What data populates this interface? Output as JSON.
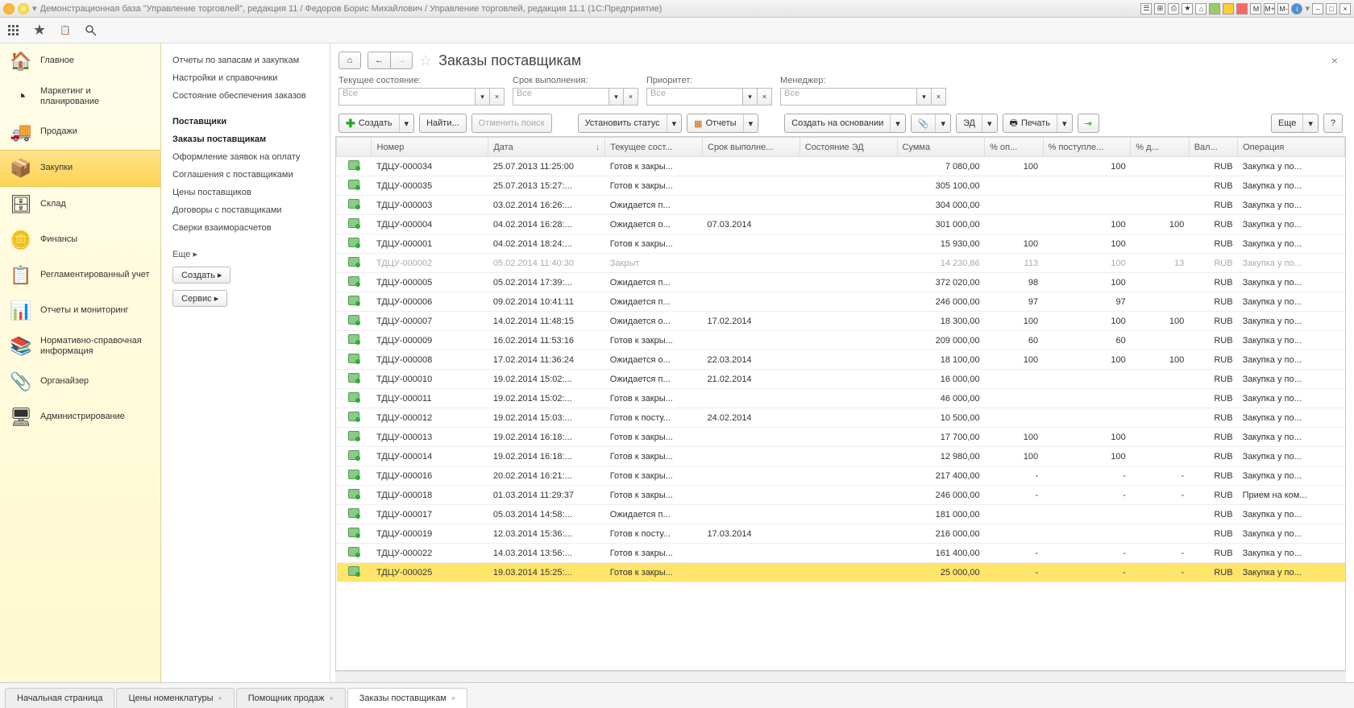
{
  "title": "Демонстрационная база \"Управление торговлей\", редакция 11 / Федоров Борис Михайлович / Управление торговлей, редакция 11.1  (1С:Предприятие)",
  "titleButtons": {
    "m": "M",
    "mp": "M+",
    "mm": "M-"
  },
  "sidebar": [
    {
      "label": "Главное",
      "icon": "home"
    },
    {
      "label": "Маркетинг и планирование",
      "icon": "pie"
    },
    {
      "label": "Продажи",
      "icon": "truck"
    },
    {
      "label": "Закупки",
      "icon": "boxes",
      "active": true
    },
    {
      "label": "Склад",
      "icon": "shelf"
    },
    {
      "label": "Финансы",
      "icon": "coins"
    },
    {
      "label": "Регламентированный учет",
      "icon": "doc"
    },
    {
      "label": "Отчеты и мониторинг",
      "icon": "chart"
    },
    {
      "label": "Нормативно-справочная информация",
      "icon": "books"
    },
    {
      "label": "Органайзер",
      "icon": "clip"
    },
    {
      "label": "Администрирование",
      "icon": "server"
    }
  ],
  "subpanel": {
    "links": [
      {
        "t": "Отчеты по запасам и закупкам"
      },
      {
        "t": "Настройки и справочники"
      },
      {
        "t": "Состояние обеспечения заказов"
      },
      {
        "t": "Поставщики",
        "bold": true
      },
      {
        "t": "Заказы поставщикам",
        "bold": true
      },
      {
        "t": "Оформление заявок на оплату"
      },
      {
        "t": "Соглашения с поставщиками"
      },
      {
        "t": "Цены поставщиков"
      },
      {
        "t": "Договоры с поставщиками"
      },
      {
        "t": "Сверки взаиморасчетов"
      }
    ],
    "more": "Еще ▸",
    "btn_create": "Создать ▸",
    "btn_service": "Сервис ▸"
  },
  "main": {
    "title": "Заказы поставщикам",
    "filters": {
      "state": {
        "label": "Текущее состояние:",
        "value": "Все"
      },
      "deadline": {
        "label": "Срок выполнения:",
        "value": "Все"
      },
      "priority": {
        "label": "Приоритет:",
        "value": "Все"
      },
      "manager": {
        "label": "Менеджер:",
        "value": "Все"
      }
    },
    "buttons": {
      "create": "Создать",
      "find": "Найти...",
      "cancel_search": "Отменить поиск",
      "set_status": "Установить статус",
      "reports": "Отчеты",
      "create_based": "Создать на основании",
      "ed": "ЭД",
      "print": "Печать",
      "more": "Еще",
      "help": "?"
    },
    "columns": [
      "",
      "Номер",
      "Дата",
      "Текущее сост...",
      "Срок выполне...",
      "Состояние ЭД",
      "Сумма",
      "% оп...",
      "% поступле...",
      "% д...",
      "Вал...",
      "Операция"
    ],
    "rows": [
      {
        "n": "ТДЦУ-000034",
        "d": "25.07.2013 11:25:00",
        "s": "Готов к закры...",
        "dl": "",
        "sum": "7 080,00",
        "op": "100",
        "pp": "100",
        "pd": "",
        "cur": "RUB",
        "oper": "Закупка у по..."
      },
      {
        "n": "ТДЦУ-000035",
        "d": "25.07.2013 15:27:...",
        "s": "Готов к закры...",
        "dl": "",
        "sum": "305 100,00",
        "op": "",
        "pp": "",
        "pd": "",
        "cur": "RUB",
        "oper": "Закупка у по..."
      },
      {
        "n": "ТДЦУ-000003",
        "d": "03.02.2014 16:26:...",
        "s": "Ожидается п...",
        "dl": "",
        "sum": "304 000,00",
        "op": "",
        "pp": "",
        "pd": "",
        "cur": "RUB",
        "oper": "Закупка у по..."
      },
      {
        "n": "ТДЦУ-000004",
        "d": "04.02.2014 16:28:...",
        "s": "Ожидается о...",
        "dl": "07.03.2014",
        "sum": "301 000,00",
        "op": "",
        "pp": "100",
        "pd": "100",
        "cur": "RUB",
        "oper": "Закупка у по...",
        "red": true
      },
      {
        "n": "ТДЦУ-000001",
        "d": "04.02.2014 18:24:...",
        "s": "Готов к закры...",
        "dl": "",
        "sum": "15 930,00",
        "op": "100",
        "pp": "100",
        "pd": "",
        "cur": "RUB",
        "oper": "Закупка у по..."
      },
      {
        "n": "ТДЦУ-000002",
        "d": "05.02.2014 11:40:30",
        "s": "Закрыт",
        "dl": "",
        "sum": "14 230,86",
        "op": "113",
        "pp": "100",
        "pd": "13",
        "cur": "RUB",
        "oper": "Закупка у по...",
        "closed": true
      },
      {
        "n": "ТДЦУ-000005",
        "d": "05.02.2014 17:39:...",
        "s": "Ожидается п...",
        "dl": "",
        "sum": "372 020,00",
        "op": "98",
        "pp": "100",
        "pd": "",
        "cur": "RUB",
        "oper": "Закупка у по..."
      },
      {
        "n": "ТДЦУ-000006",
        "d": "09.02.2014 10:41:11",
        "s": "Ожидается п...",
        "dl": "",
        "sum": "246 000,00",
        "op": "97",
        "pp": "97",
        "pd": "",
        "cur": "RUB",
        "oper": "Закупка у по..."
      },
      {
        "n": "ТДЦУ-000007",
        "d": "14.02.2014 11:48:15",
        "s": "Ожидается о...",
        "dl": "17.02.2014",
        "sum": "18 300,00",
        "op": "100",
        "pp": "100",
        "pd": "100",
        "cur": "RUB",
        "oper": "Закупка у по...",
        "red": true
      },
      {
        "n": "ТДЦУ-000009",
        "d": "16.02.2014 11:53:16",
        "s": "Готов к закры...",
        "dl": "",
        "sum": "209 000,00",
        "op": "60",
        "pp": "60",
        "pd": "",
        "cur": "RUB",
        "oper": "Закупка у по..."
      },
      {
        "n": "ТДЦУ-000008",
        "d": "17.02.2014 11:36:24",
        "s": "Ожидается о...",
        "dl": "22.03.2014",
        "sum": "18 100,00",
        "op": "100",
        "pp": "100",
        "pd": "100",
        "cur": "RUB",
        "oper": "Закупка у по...",
        "red": true
      },
      {
        "n": "ТДЦУ-000010",
        "d": "19.02.2014 15:02:...",
        "s": "Ожидается п...",
        "dl": "21.02.2014",
        "sum": "16 000,00",
        "op": "",
        "pp": "",
        "pd": "",
        "cur": "RUB",
        "oper": "Закупка у по...",
        "red": true
      },
      {
        "n": "ТДЦУ-000011",
        "d": "19.02.2014 15:02:...",
        "s": "Готов к закры...",
        "dl": "",
        "sum": "46 000,00",
        "op": "",
        "pp": "",
        "pd": "",
        "cur": "RUB",
        "oper": "Закупка у по..."
      },
      {
        "n": "ТДЦУ-000012",
        "d": "19.02.2014 15:03:...",
        "s": "Готов к посту...",
        "dl": "24.02.2014",
        "sum": "10 500,00",
        "op": "",
        "pp": "",
        "pd": "",
        "cur": "RUB",
        "oper": "Закупка у по...",
        "red": true
      },
      {
        "n": "ТДЦУ-000013",
        "d": "19.02.2014 16:18:...",
        "s": "Готов к закры...",
        "dl": "",
        "sum": "17 700,00",
        "op": "100",
        "pp": "100",
        "pd": "",
        "cur": "RUB",
        "oper": "Закупка у по..."
      },
      {
        "n": "ТДЦУ-000014",
        "d": "19.02.2014 16:18:...",
        "s": "Готов к закры...",
        "dl": "",
        "sum": "12 980,00",
        "op": "100",
        "pp": "100",
        "pd": "",
        "cur": "RUB",
        "oper": "Закупка у по..."
      },
      {
        "n": "ТДЦУ-000016",
        "d": "20.02.2014 16:21:...",
        "s": "Готов к закры...",
        "dl": "",
        "sum": "217 400,00",
        "op": "-",
        "pp": "-",
        "pd": "-",
        "cur": "RUB",
        "oper": "Закупка у по..."
      },
      {
        "n": "ТДЦУ-000018",
        "d": "01.03.2014 11:29:37",
        "s": "Готов к закры...",
        "dl": "",
        "sum": "246 000,00",
        "op": "-",
        "pp": "-",
        "pd": "-",
        "cur": "RUB",
        "oper": "Прием на ком..."
      },
      {
        "n": "ТДЦУ-000017",
        "d": "05.03.2014 14:58:...",
        "s": "Ожидается п...",
        "dl": "",
        "sum": "181 000,00",
        "op": "",
        "pp": "",
        "pd": "",
        "cur": "RUB",
        "oper": "Закупка у по..."
      },
      {
        "n": "ТДЦУ-000019",
        "d": "12.03.2014 15:36:...",
        "s": "Готов к посту...",
        "dl": "17.03.2014",
        "sum": "216 000,00",
        "op": "",
        "pp": "",
        "pd": "",
        "cur": "RUB",
        "oper": "Закупка у по...",
        "red": true
      },
      {
        "n": "ТДЦУ-000022",
        "d": "14.03.2014 13:56:...",
        "s": "Готов к закры...",
        "dl": "",
        "sum": "161 400,00",
        "op": "-",
        "pp": "-",
        "pd": "-",
        "cur": "RUB",
        "oper": "Закупка у по..."
      },
      {
        "n": "ТДЦУ-000025",
        "d": "19.03.2014 15:25:...",
        "s": "Готов к закры...",
        "dl": "",
        "sum": "25 000,00",
        "op": "-",
        "pp": "-",
        "pd": "-",
        "cur": "RUB",
        "oper": "Закупка у по...",
        "sel": true
      }
    ]
  },
  "tabs": [
    {
      "t": "Начальная страница"
    },
    {
      "t": "Цены номенклатуры",
      "x": true
    },
    {
      "t": "Помощник продаж",
      "x": true
    },
    {
      "t": "Заказы поставщикам",
      "x": true,
      "active": true
    }
  ]
}
